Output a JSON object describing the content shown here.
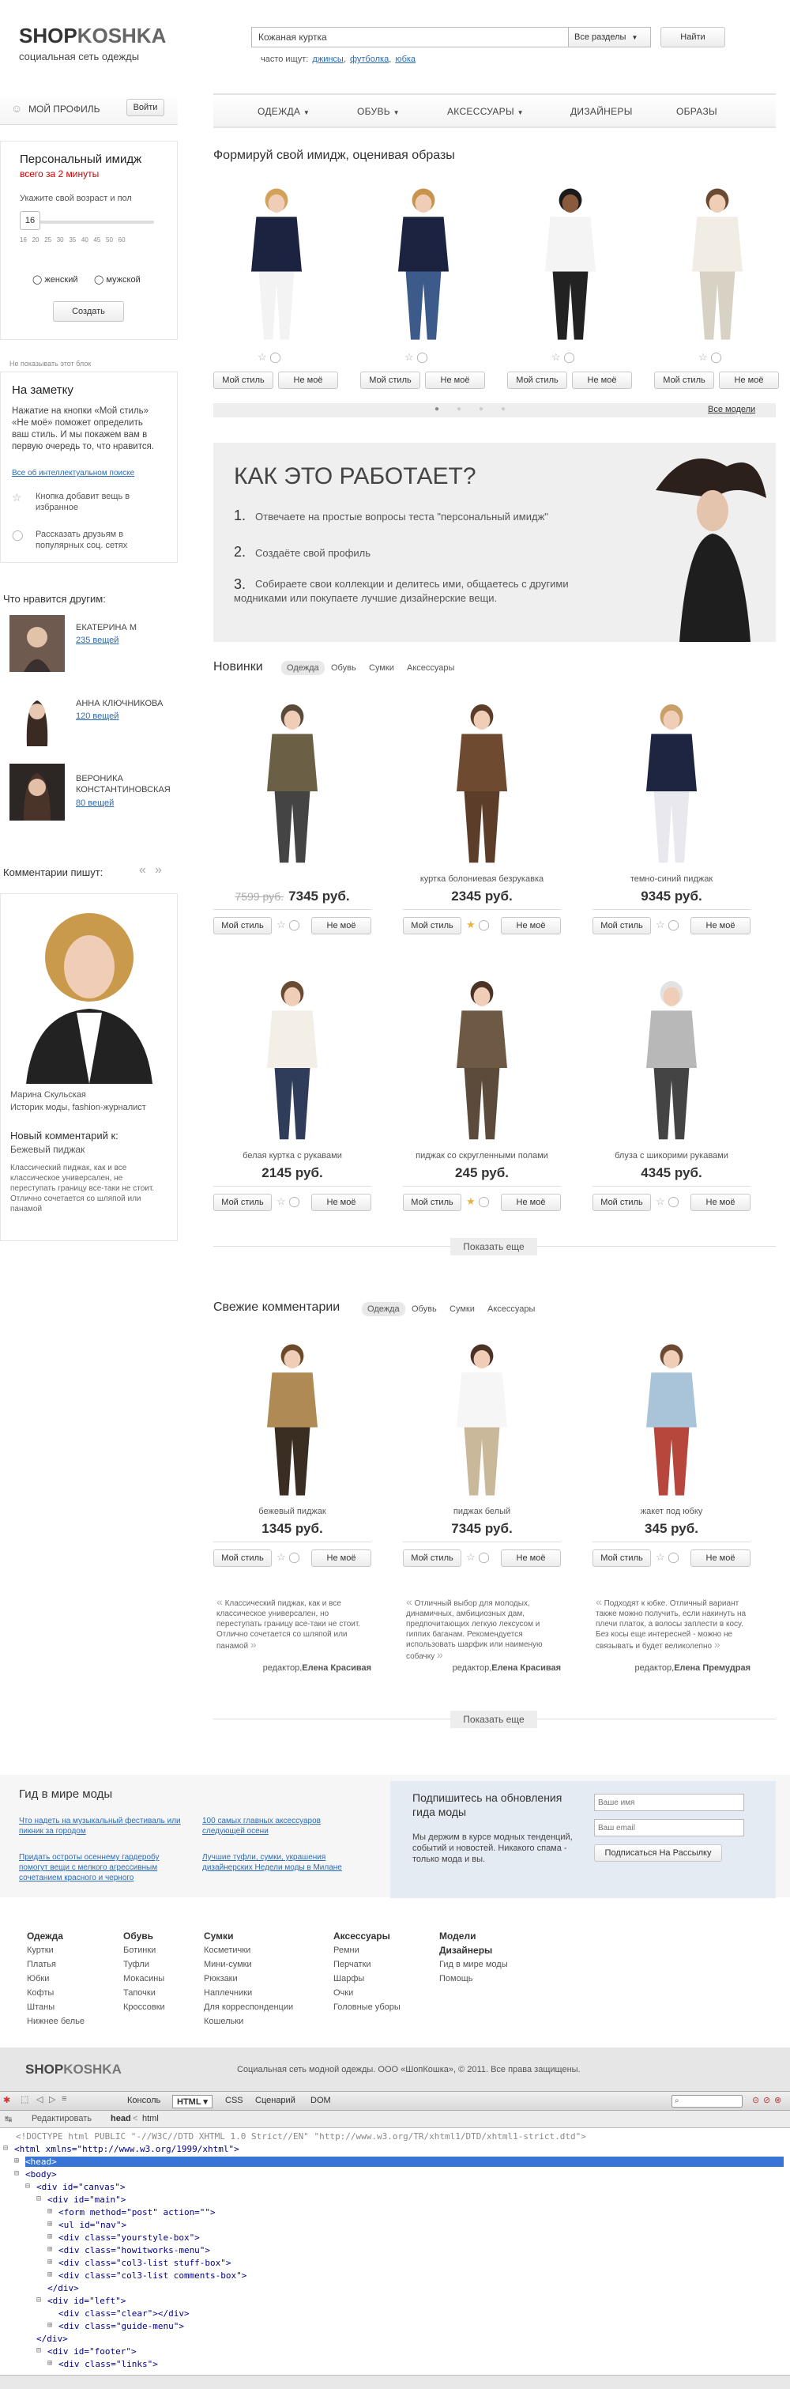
{
  "header": {
    "logo_a": "SHOP",
    "logo_b": "KOSHKA",
    "tagline": "социальная сеть одежды",
    "search_value": "Кожаная куртка",
    "search_section": "Все разделы",
    "search_button": "Найти",
    "hints_label": "часто ищут:",
    "hints": [
      "джинсы",
      "футболка",
      "юбка"
    ]
  },
  "profile": {
    "label": "МОЙ ПРОФИЛЬ",
    "login": "Войти"
  },
  "nav": [
    "ОДЕЖДА",
    "ОБУВЬ",
    "АКСЕССУАРЫ",
    "ДИЗАЙНЕРЫ",
    "ОБРАЗЫ"
  ],
  "image_panel": {
    "title": "Персональный имидж",
    "subtitle": "всего за 2 минуты",
    "age_label": "Укажите свой возраст и пол",
    "age_value": "16",
    "ticks": [
      "16",
      "20",
      "25",
      "30",
      "35",
      "40",
      "45",
      "50",
      "60"
    ],
    "female": "женский",
    "male": "мужской",
    "create": "Создать"
  },
  "note": {
    "hide": "Не показывать этот блок",
    "title": "На заметку",
    "text": "Нажатие на кнопки «Мой стиль» «Не моё» поможет определить ваш стиль. И мы покажем вам в первую очередь то, что нравится.",
    "link": "Все об интеллектуальном поиске",
    "tip1": "Кнопка добавит вещь в избранное",
    "tip2": "Рассказать друзьям в популярных соц. сетях"
  },
  "others": {
    "title": "Что нравится другим:",
    "people": [
      {
        "name": "ЕКАТЕРИНА М",
        "count": "235 вещей"
      },
      {
        "name": "АННА КЛЮЧНИКОВА",
        "count": "120 вещей"
      },
      {
        "name": "ВЕРОНИКА КОНСТАНТИНОВСКАЯ",
        "count": "80 вещей"
      }
    ]
  },
  "comments_side": {
    "title": "Комментарии пишут:",
    "author": "Марина Скульская",
    "role": "Историк моды, fashion-журналист",
    "new_label": "Новый комментарий к:",
    "item": "Бежевый пиджак",
    "text": "Классический пиджак, как и все классическое универсален, не переступать границу все-таки не стоит. Отлично сочетается со шляпой или панамой"
  },
  "style": {
    "title": "Формируй свой имидж, оценивая образы",
    "my": "Мой стиль",
    "not": "Не моё",
    "all": "Все модели"
  },
  "howto": {
    "title": "КАК ЭТО РАБОТАЕТ?",
    "steps": [
      "Отвечаете на простые вопросы теста \"персональный имидж\"",
      "Создаёте свой профиль",
      "Собираете свои коллекции и делитесь ими, общаетесь с другими модниками или покупаете лучшие дизайнерские вещи."
    ]
  },
  "news": {
    "title": "Новинки",
    "tabs": [
      "Одежда",
      "Обувь",
      "Сумки",
      "Аксессуары"
    ],
    "items": [
      {
        "caption": "",
        "old": "7599 руб.",
        "price": "7345 руб."
      },
      {
        "caption": "куртка болониевая безрукавка",
        "old": "",
        "price": "2345 руб."
      },
      {
        "caption": "темно-синий пиджак",
        "old": "",
        "price": "9345 руб."
      },
      {
        "caption": "белая куртка с рукавами",
        "old": "",
        "price": "2145 руб."
      },
      {
        "caption": "пиджак со скругленными полами",
        "old": "",
        "price": "245 руб."
      },
      {
        "caption": "блуза с шикорими рукавами",
        "old": "",
        "price": "4345 руб."
      }
    ],
    "more": "Показать еще"
  },
  "fresh": {
    "title": "Свежие комментарии",
    "tabs": [
      "Одежда",
      "Обувь",
      "Сумки",
      "Аксессуары"
    ],
    "items": [
      {
        "caption": "бежевый пиджак",
        "price": "1345 руб.",
        "quote": "Классический пиджак, как и все классическое универсален, но переступать границу все-таки не стоит. Отлично сочетается со шляпой или панамой",
        "editor_label": "редактор,",
        "editor": "Елена Красивая"
      },
      {
        "caption": "пиджак белый",
        "price": "7345 руб.",
        "quote": "Отличный выбор для молодых, динамичных, амбициозных дам, предпочитающих легкую лексусом и гиппих баганам. Рекомендуется использовать шарфик или наименую собачку",
        "editor_label": "редактор,",
        "editor": "Елена Красивая"
      },
      {
        "caption": "жакет под юбку",
        "price": "345 руб.",
        "quote": "Подходят к юбке. Отличный вариант также можно получить, если накинуть на плечи платок, а волосы заплести в косу. Без косы еще интересней - можно не связывать и будет великолепно",
        "editor_label": "редактор,",
        "editor": "Елена Премудрая"
      }
    ],
    "more": "Показать еще"
  },
  "guide": {
    "title": "Гид в мире моды",
    "links": [
      "Что надеть на музыкальный фестиваль или пикник за городом",
      "100 самых главных аксессуаров следующей осени",
      "Придать остроты осеннему гардеробу помогут вещи с мелкого агрессивным сочетанием красного и черного",
      "Лучшие туфли, сумки, украшения дизайнерских Недели моды в Милане"
    ]
  },
  "subscribe": {
    "title": "Подпишитесь на обновления гида моды",
    "text": "Мы держим в курсе модных тенденций, событий и новостей. Никакого спама - только мода и вы.",
    "name_ph": "Ваше имя",
    "email_ph": "Ваш email",
    "button": "Подписаться На Рассылку"
  },
  "footer": {
    "cols": [
      {
        "h": "Одежда",
        "items": [
          "Куртки",
          "Платья",
          "Юбки",
          "Кофты",
          "Штаны",
          "Нижнее белье"
        ]
      },
      {
        "h": "Обувь",
        "items": [
          "Ботинки",
          "Туфли",
          "Мокасины",
          "Тапочки",
          "Кроссовки"
        ]
      },
      {
        "h": "Сумки",
        "items": [
          "Косметички",
          "Мини-сумки",
          "Рюкзаки",
          "Наплечники",
          "Для корреспонденции",
          "Кошельки"
        ]
      },
      {
        "h": "Аксессуары",
        "items": [
          "Ремни",
          "Перчатки",
          "Шарфы",
          "Очки",
          "Головные уборы"
        ]
      },
      {
        "h": "Модели",
        "items": []
      },
      {
        "h": "Дизайнеры",
        "items": [
          "Гид в мире моды",
          "Помощь"
        ]
      }
    ],
    "copyright": "Социальная сеть модной одежды. ООО «ШопКошка», © 2011. Все права защищены."
  },
  "devtools": {
    "tabs": [
      "Консоль",
      "HTML",
      "CSS",
      "Сценарий",
      "DOM"
    ],
    "edit": "Редактировать",
    "crumb1": "head",
    "crumb2": "html",
    "doctype": "<!DOCTYPE html PUBLIC \"-//W3C//DTD XHTML 1.0 Strict//EN\" \"http://www.w3.org/TR/xhtml1/DTD/xhtml1-strict.dtd\">",
    "lines": [
      "<html xmlns=\"http://www.w3.org/1999/xhtml\">",
      "<head>",
      "<body>",
      "<div id=\"canvas\">",
      "<div id=\"main\">",
      "<form method=\"post\" action=\"\">",
      "<ul id=\"nav\">",
      "<div class=\"yourstyle-box\">",
      "<div class=\"howitworks-menu\">",
      "<div class=\"col3-list stuff-box\">",
      "<div class=\"col3-list comments-box\">",
      "</div>",
      "<div id=\"left\">",
      "<div class=\"clear\"></div>",
      "<div class=\"guide-menu\">",
      "</div>",
      "<div id=\"footer\">",
      "<div class=\"links\">"
    ]
  }
}
